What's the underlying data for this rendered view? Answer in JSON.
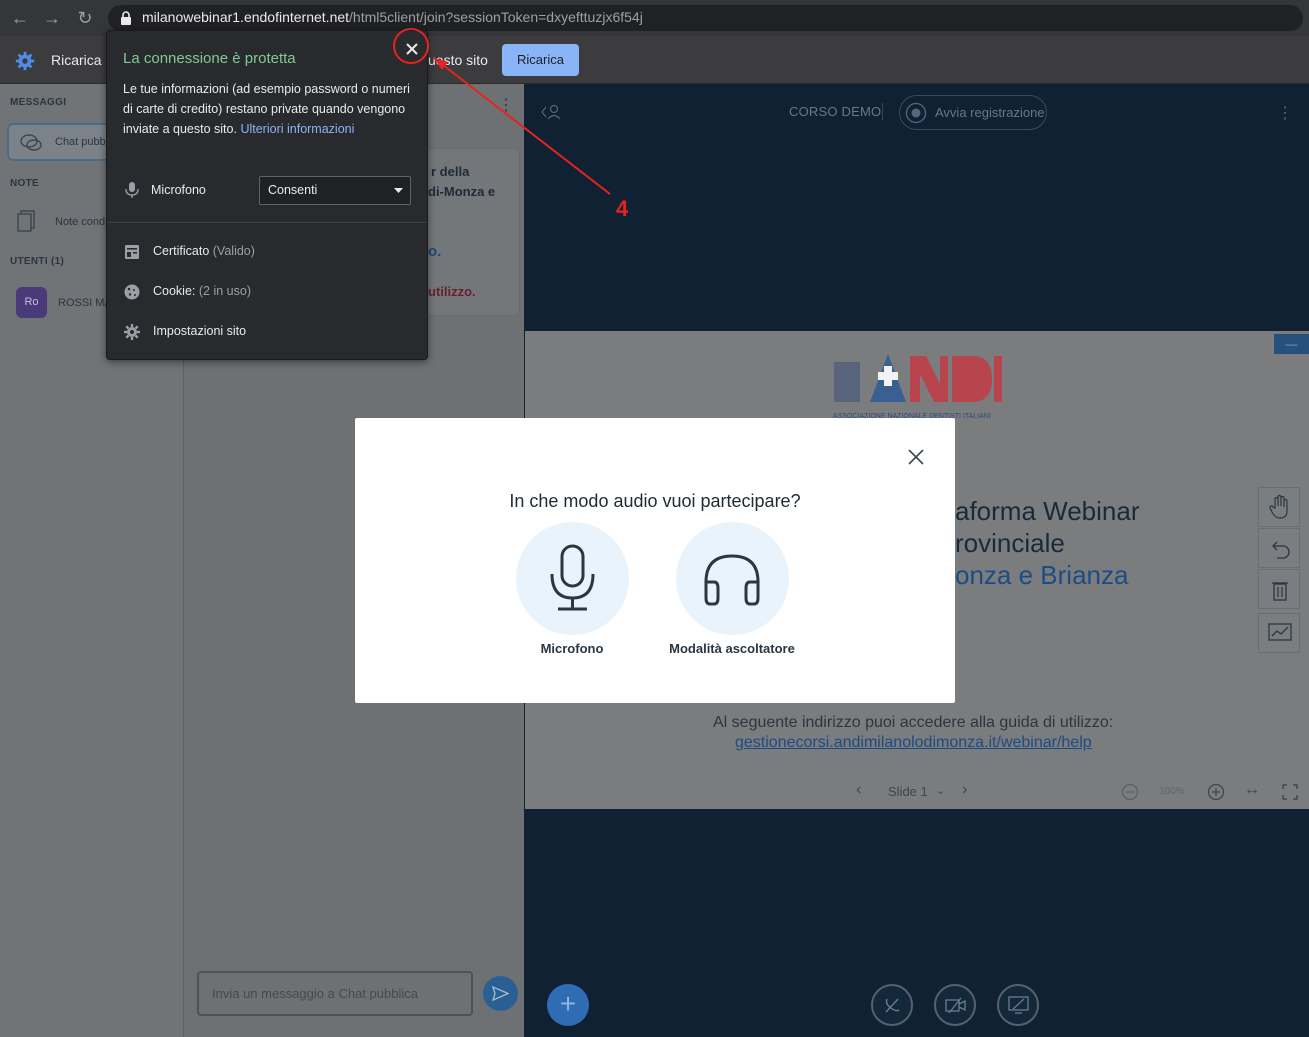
{
  "browser": {
    "url_host": "milanowebinar1.endofinternet.net",
    "url_path": "/html5client/join?sessionToken=dxyefttuzjx6f54j"
  },
  "infobar": {
    "text_left": "Ricarica l",
    "text_right": "uesto sito",
    "reload_button": "Ricarica"
  },
  "popup": {
    "title": "La connessione è protetta",
    "description": "Le tue informazioni (ad esempio password o numeri di carte di credito) restano private quando vengono inviate a questo sito.",
    "more_info_link": "Ulteriori informazioni",
    "mic_label": "Microfono",
    "mic_permission": "Consenti",
    "certificate_label": "Certificato",
    "certificate_status": "(Valido)",
    "cookie_label": "Cookie:",
    "cookie_status": "(2 in uso)",
    "site_settings_label": "Impostazioni sito"
  },
  "sidebar": {
    "messages_title": "MESSAGGI",
    "chat_item": "Chat pubb",
    "notes_title": "NOTE",
    "notes_item": "Note cond",
    "users_title": "UTENTI (1)",
    "user_avatar": "Ro",
    "user_name": "ROSSI MA"
  },
  "chat": {
    "welcome_line1": "r della",
    "welcome_line2": "di-Monza e",
    "welcome_line3": "o.",
    "welcome_line4": "utilizzo.",
    "input_placeholder": "Invia un messaggio a Chat pubblica"
  },
  "main": {
    "session_name": "CORSO DEMO",
    "record_button": "Avvia registrazione",
    "slide_heading1": "aforma Webinar",
    "slide_heading2": "rovinciale",
    "slide_heading3": "onza e Brianza",
    "slide_guide_text": "Al seguente indirizzo puoi accedere alla guida di utilizzo:",
    "slide_guide_link": "gestionecorsi.andimilanolodimonza.it/webinar/help",
    "slide_selector": "Slide 1",
    "zoom_level": "100%",
    "logo_caption": "ASSOCIAZIONE NAZIONALE DENTISTI ITALIANI"
  },
  "modal": {
    "title": "In che modo audio vuoi partecipare?",
    "option_mic": "Microfono",
    "option_listen": "Modalità ascoltatore"
  },
  "annotation": {
    "number": "4"
  },
  "colors": {
    "accent": "#8ab4f8",
    "annotation": "#e8231d",
    "popup_title": "#81c995"
  }
}
